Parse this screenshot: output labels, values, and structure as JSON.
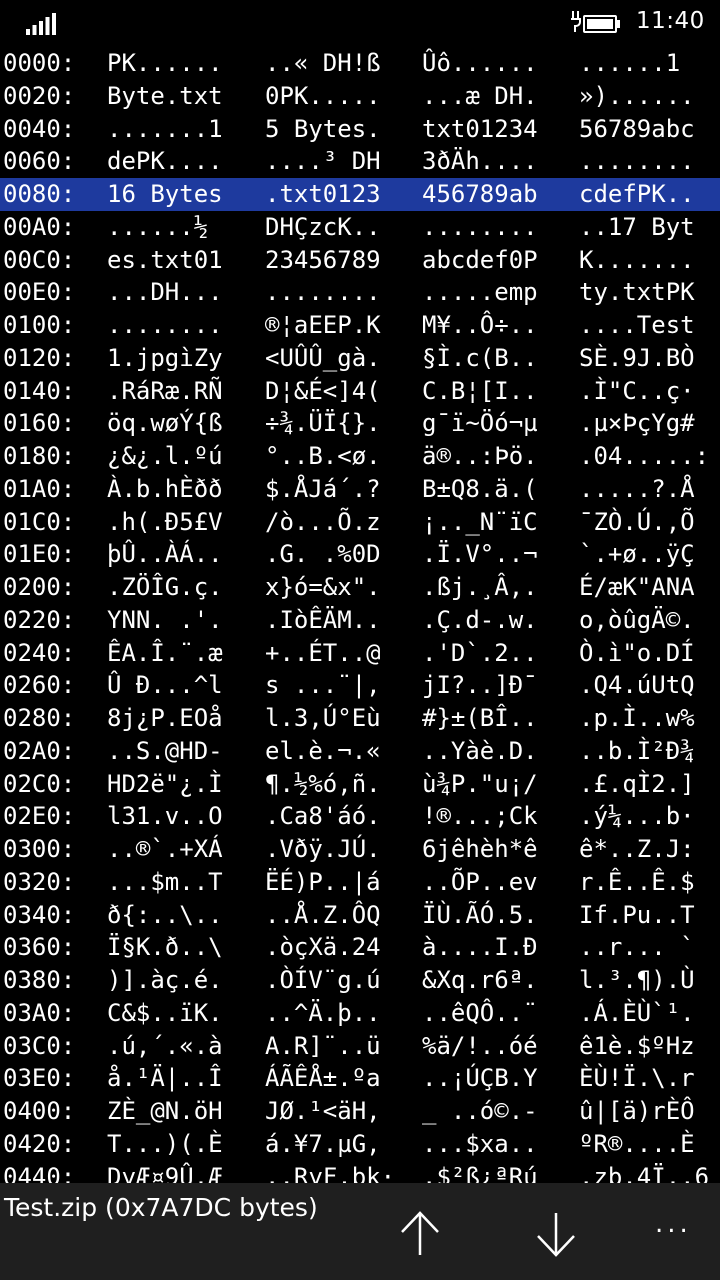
{
  "status_bar": {
    "time": "11:40",
    "signal_icon": "signal-strength-icon",
    "battery_icon": "battery-charging-icon"
  },
  "hex_rows": [
    {
      "addr": "0000:",
      "g": [
        "PK......",
        "..« DH!ß",
        "Ûô......",
        "......1 "
      ]
    },
    {
      "addr": "0020:",
      "g": [
        "Byte.txt",
        "0PK.....",
        "...æ DH.",
        "»)......"
      ]
    },
    {
      "addr": "0040:",
      "g": [
        ".......1",
        "5 Bytes.",
        "txt01234",
        "56789abc"
      ]
    },
    {
      "addr": "0060:",
      "g": [
        "dePK....",
        "....³ DH",
        "3ðÄh....",
        "........"
      ]
    },
    {
      "addr": "0080:",
      "g": [
        "16 Bytes",
        ".txt0123",
        "456789ab",
        "cdefPK.."
      ],
      "selected": true
    },
    {
      "addr": "00A0:",
      "g": [
        "......½ ",
        "DHÇzcK..",
        "........",
        "..17 Byt"
      ]
    },
    {
      "addr": "00C0:",
      "g": [
        "es.txt01",
        "23456789",
        "abcdef0P",
        "K......."
      ]
    },
    {
      "addr": "00E0:",
      "g": [
        "...DH...",
        "........",
        ".....emp",
        "ty.txtPK"
      ]
    },
    {
      "addr": "0100:",
      "g": [
        "........",
        "®¦aEEP.K",
        "M¥..Ô÷..",
        "....Test"
      ]
    },
    {
      "addr": "0120:",
      "g": [
        "1.jpgìZy",
        "<UÛÛ_gà.",
        "§Ì.c(B..",
        "SÈ.9J.BÒ"
      ]
    },
    {
      "addr": "0140:",
      "g": [
        ".RáRæ.RÑ",
        "D¦&É<]4(",
        "C.B¦[I..",
        ".Ì\"C..ç·"
      ]
    },
    {
      "addr": "0160:",
      "g": [
        "öq.wøÝ{ß",
        "÷¾.ÜÏ{}.",
        "g¯ï~Öó¬µ",
        ".µ×ÞçYg#"
      ]
    },
    {
      "addr": "0180:",
      "g": [
        "¿&¿.l.ºú",
        "°..B.<ø.",
        "ä®..:Þö.",
        ".04.....:"
      ]
    },
    {
      "addr": "01A0:",
      "g": [
        "À.b.hÈðð",
        "$.ÅJá´.?",
        "B±Q8.ä.(",
        ".....?.Å"
      ]
    },
    {
      "addr": "01C0:",
      "g": [
        ".h(.Ð5£V",
        "/ò...Õ.z",
        "¡.._N¨ïC",
        "¯ZÒ.Ú.,Õ"
      ]
    },
    {
      "addr": "01E0:",
      "g": [
        "þÛ..ÀÁ..",
        ".G. .%0D",
        ".Ï.V°..¬",
        "`.+ø..ÿÇ"
      ]
    },
    {
      "addr": "0200:",
      "g": [
        ".ZÖÎG.ç.",
        "x}ó=&x\".",
        ".ßj.¸Â,.",
        "É/æK\"ANA"
      ]
    },
    {
      "addr": "0220:",
      "g": [
        "YNN. .'.",
        ".IòÊÄM..",
        ".Ç.d-.w.",
        "o,òûgÄ©."
      ]
    },
    {
      "addr": "0240:",
      "g": [
        "ÊA.Î.¨.æ",
        "+..ÉT..@",
        ".'D`.2..",
        "Ò.ì\"o.DÍ"
      ]
    },
    {
      "addr": "0260:",
      "g": [
        "Û Ð...^l",
        "s ...¨|,",
        "jI?..]Ð¯",
        ".Q4.úUtQ"
      ]
    },
    {
      "addr": "0280:",
      "g": [
        "8j¿P.EOå",
        "l.3,Ú°Eù",
        "#}±(BÎ..",
        ".p.Ì..w%"
      ]
    },
    {
      "addr": "02A0:",
      "g": [
        "..S.@HD-",
        "el.è.¬.«",
        "..Yàè.D.",
        "..b.Ì²Ð¾"
      ]
    },
    {
      "addr": "02C0:",
      "g": [
        "HD2ë\"¿.Ì",
        "¶.½%ó,ñ.",
        "ù¾P.\"u¡/",
        ".£.qÌ2.]"
      ]
    },
    {
      "addr": "02E0:",
      "g": [
        "l31.v..O",
        ".Ca8'áó.",
        "!®...;Ck",
        ".ý¼...b·"
      ]
    },
    {
      "addr": "0300:",
      "g": [
        "..®`.+XÁ",
        ".Vðÿ.JÚ.",
        "6jêhèh*ê",
        "ê*..Z.J:"
      ]
    },
    {
      "addr": "0320:",
      "g": [
        "...$m..T",
        "ËÉ)P..|á",
        "..ÕP..ev",
        "r.Ê..Ê.$"
      ]
    },
    {
      "addr": "0340:",
      "g": [
        "ð{:..\\..",
        "..Å.Z.ÔQ",
        "ÏÙ.ÃÓ.5.",
        "If.Pu..T"
      ]
    },
    {
      "addr": "0360:",
      "g": [
        "Ï§K.ð..\\",
        ".òçXä.24",
        "à....I.Ð",
        "..r... `"
      ]
    },
    {
      "addr": "0380:",
      "g": [
        ")].àç.é.",
        ".ÒÍV¨g.ú",
        "&Xq.r6ª.",
        "l.³.¶).Ù"
      ]
    },
    {
      "addr": "03A0:",
      "g": [
        "C&$..ïK.",
        "..^Ä.þ..",
        "..êQÔ..¨",
        ".Á.ÈÙ`¹."
      ]
    },
    {
      "addr": "03C0:",
      "g": [
        ".ú,´.«.à",
        "A.R]¨..ü",
        "%ä/!..óé",
        "ê1è.$ºHz"
      ]
    },
    {
      "addr": "03E0:",
      "g": [
        "å.¹Ä|..Î",
        "ÁÃÊÅ±.ºa",
        "..¡ÚÇB.Y",
        "ÈÙ!Ï.\\.r"
      ]
    },
    {
      "addr": "0400:",
      "g": [
        "ZÈ_@N.öH",
        "JØ.¹<äH,",
        "_ ..ó©.-",
        "û|[ä)rÈÔ"
      ]
    },
    {
      "addr": "0420:",
      "g": [
        "T...)(.È",
        "á.¥7.µG,",
        "...$xa..",
        "ºR®....È"
      ]
    },
    {
      "addr": "0440:",
      "g": [
        "DyÆ¤9Û.Æ",
        "..RyF.bk·",
        ".$²ß¿ªRú",
        ".zb.4Ï..6"
      ]
    }
  ],
  "app_bar": {
    "file_title": "Test.zip (0x7A7DC bytes)",
    "up_icon": "arrow-up-icon",
    "down_icon": "arrow-down-icon",
    "more_label": "..."
  }
}
